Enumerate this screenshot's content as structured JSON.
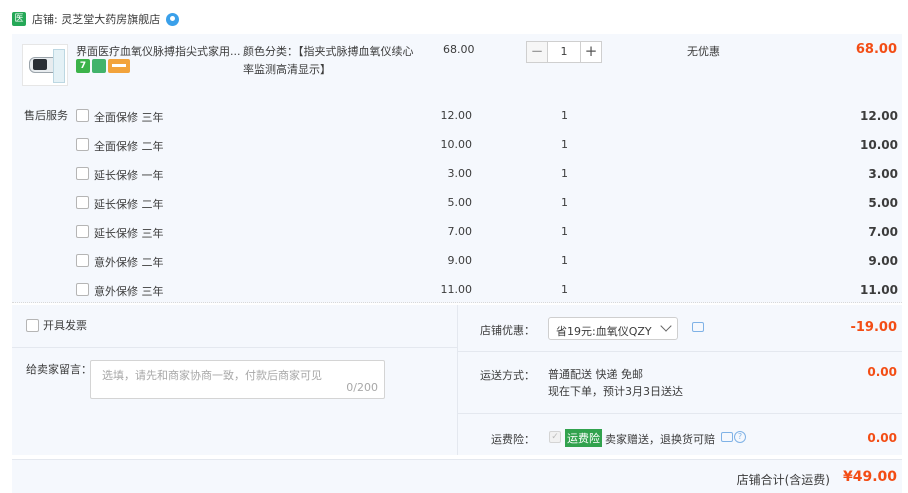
{
  "store": {
    "badge": "医",
    "label": "店铺: 灵芝堂大药房旗舰店"
  },
  "product": {
    "title": "界面医疗血氧仪脉搏指尖式家用...",
    "badges": {
      "b7": "7"
    },
    "spec": "颜色分类：【指夹式脉搏血氧仪续心率监测高清显示】",
    "unit_price": "68.00",
    "quantity": "1",
    "minus": "−",
    "plus": "+",
    "discount": "无优惠",
    "subtotal": "68.00"
  },
  "services": {
    "label": "售后服务",
    "items": [
      {
        "name": "全面保修 三年",
        "price": "12.00",
        "qty": "1",
        "subtotal": "12.00"
      },
      {
        "name": "全面保修 二年",
        "price": "10.00",
        "qty": "1",
        "subtotal": "10.00"
      },
      {
        "name": "延长保修 一年",
        "price": "3.00",
        "qty": "1",
        "subtotal": "3.00"
      },
      {
        "name": "延长保修 二年",
        "price": "5.00",
        "qty": "1",
        "subtotal": "5.00"
      },
      {
        "name": "延长保修 三年",
        "price": "7.00",
        "qty": "1",
        "subtotal": "7.00"
      },
      {
        "name": "意外保修 二年",
        "price": "9.00",
        "qty": "1",
        "subtotal": "9.00"
      },
      {
        "name": "意外保修 三年",
        "price": "11.00",
        "qty": "1",
        "subtotal": "11.00"
      }
    ]
  },
  "order": {
    "invoice_label": "开具发票",
    "message_label": "给卖家留言：",
    "message_placeholder": "选填，请先和商家协商一致，付款后商家可见",
    "message_count": "0/200",
    "promo_label": "店铺优惠：",
    "promo_selected": "省19元:血氧仪QZY",
    "promo_value": "-19.00",
    "shipping_label": "运送方式：",
    "shipping_line1": "普通配送 快递 免邮",
    "shipping_line2": "现在下单，预计3月3日送达",
    "shipping_value": "0.00",
    "insurance_label": "运费险：",
    "insurance_check": "✓",
    "insurance_tag": "运费险",
    "insurance_desc": "卖家赠送，退换货可赔",
    "insurance_help": "?",
    "insurance_value": "0.00"
  },
  "total": {
    "label": "店铺合计(含运费)",
    "value": "¥49.00"
  },
  "colors": {
    "accent": "#f34d15",
    "panel": "#f5f8fd",
    "badge_green": "#25a857"
  }
}
